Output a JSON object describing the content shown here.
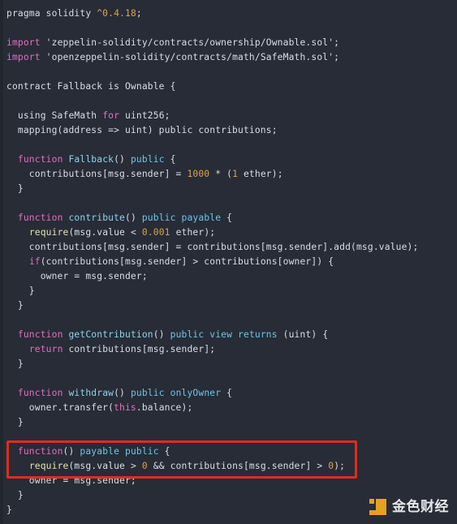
{
  "editor": {
    "language": "solidity",
    "theme_background": "#272c36",
    "default_text_color": "#d9dde6",
    "colors": {
      "keyword": "#e36ec4",
      "modifier": "#6fc3e8",
      "function_name": "#8fd3ec",
      "number": "#e0a04a",
      "builtin_call": "#e8e2a8",
      "plain": "#d9dde6",
      "annotation_box": "#e02b20",
      "watermark_accent": "#f0a81e"
    },
    "lines": [
      {
        "n": 1,
        "tokens": [
          {
            "t": "pragma solidity ",
            "c": "plain"
          },
          {
            "t": "^0.4.18",
            "c": "num"
          },
          {
            "t": ";",
            "c": "plain"
          }
        ]
      },
      {
        "n": 2,
        "tokens": []
      },
      {
        "n": 3,
        "tokens": [
          {
            "t": "import",
            "c": "kw"
          },
          {
            "t": " 'zeppelin-solidity/contracts/ownership/Ownable.sol';",
            "c": "plain"
          }
        ]
      },
      {
        "n": 4,
        "tokens": [
          {
            "t": "import",
            "c": "kw"
          },
          {
            "t": " 'openzeppelin-solidity/contracts/math/SafeMath.sol';",
            "c": "plain"
          }
        ]
      },
      {
        "n": 5,
        "tokens": []
      },
      {
        "n": 6,
        "tokens": [
          {
            "t": "contract Fallback is Ownable {",
            "c": "plain"
          }
        ]
      },
      {
        "n": 7,
        "tokens": []
      },
      {
        "n": 8,
        "tokens": [
          {
            "t": "  using SafeMath ",
            "c": "plain"
          },
          {
            "t": "for",
            "c": "kw"
          },
          {
            "t": " uint256;",
            "c": "plain"
          }
        ]
      },
      {
        "n": 9,
        "tokens": [
          {
            "t": "  mapping(address => uint) public contributions;",
            "c": "plain"
          }
        ]
      },
      {
        "n": 10,
        "tokens": []
      },
      {
        "n": 11,
        "tokens": [
          {
            "t": "  ",
            "c": "plain"
          },
          {
            "t": "function",
            "c": "kw"
          },
          {
            "t": " ",
            "c": "plain"
          },
          {
            "t": "Fallback",
            "c": "fname"
          },
          {
            "t": "() ",
            "c": "plain"
          },
          {
            "t": "public",
            "c": "mod"
          },
          {
            "t": " {",
            "c": "plain"
          }
        ]
      },
      {
        "n": 12,
        "tokens": [
          {
            "t": "    contributions[msg.sender] = ",
            "c": "plain"
          },
          {
            "t": "1000",
            "c": "num"
          },
          {
            "t": " * (",
            "c": "plain"
          },
          {
            "t": "1",
            "c": "num"
          },
          {
            "t": " ether);",
            "c": "plain"
          }
        ]
      },
      {
        "n": 13,
        "tokens": [
          {
            "t": "  }",
            "c": "plain"
          }
        ]
      },
      {
        "n": 14,
        "tokens": []
      },
      {
        "n": 15,
        "tokens": [
          {
            "t": "  ",
            "c": "plain"
          },
          {
            "t": "function",
            "c": "kw"
          },
          {
            "t": " ",
            "c": "plain"
          },
          {
            "t": "contribute",
            "c": "fname"
          },
          {
            "t": "() ",
            "c": "plain"
          },
          {
            "t": "public payable",
            "c": "mod"
          },
          {
            "t": " {",
            "c": "plain"
          }
        ]
      },
      {
        "n": 16,
        "tokens": [
          {
            "t": "    ",
            "c": "plain"
          },
          {
            "t": "require",
            "c": "call"
          },
          {
            "t": "(msg.value < ",
            "c": "plain"
          },
          {
            "t": "0.001",
            "c": "num"
          },
          {
            "t": " ether);",
            "c": "plain"
          }
        ]
      },
      {
        "n": 17,
        "tokens": [
          {
            "t": "    contributions[msg.sender] = contributions[msg.sender].add(msg.value);",
            "c": "plain"
          }
        ]
      },
      {
        "n": 18,
        "tokens": [
          {
            "t": "    ",
            "c": "plain"
          },
          {
            "t": "if",
            "c": "kw"
          },
          {
            "t": "(contributions[msg.sender] > contributions[owner]) {",
            "c": "plain"
          }
        ]
      },
      {
        "n": 19,
        "tokens": [
          {
            "t": "      owner = msg.sender;",
            "c": "plain"
          }
        ]
      },
      {
        "n": 20,
        "tokens": [
          {
            "t": "    }",
            "c": "plain"
          }
        ]
      },
      {
        "n": 21,
        "tokens": [
          {
            "t": "  }",
            "c": "plain"
          }
        ]
      },
      {
        "n": 22,
        "tokens": []
      },
      {
        "n": 23,
        "tokens": [
          {
            "t": "  ",
            "c": "plain"
          },
          {
            "t": "function",
            "c": "kw"
          },
          {
            "t": " ",
            "c": "plain"
          },
          {
            "t": "getContribution",
            "c": "fname"
          },
          {
            "t": "() ",
            "c": "plain"
          },
          {
            "t": "public view returns",
            "c": "mod"
          },
          {
            "t": " (uint) {",
            "c": "plain"
          }
        ]
      },
      {
        "n": 24,
        "tokens": [
          {
            "t": "    ",
            "c": "plain"
          },
          {
            "t": "return",
            "c": "kw"
          },
          {
            "t": " contributions[msg.sender];",
            "c": "plain"
          }
        ]
      },
      {
        "n": 25,
        "tokens": [
          {
            "t": "  }",
            "c": "plain"
          }
        ]
      },
      {
        "n": 26,
        "tokens": []
      },
      {
        "n": 27,
        "tokens": [
          {
            "t": "  ",
            "c": "plain"
          },
          {
            "t": "function",
            "c": "kw"
          },
          {
            "t": " ",
            "c": "plain"
          },
          {
            "t": "withdraw",
            "c": "fname"
          },
          {
            "t": "() ",
            "c": "plain"
          },
          {
            "t": "public onlyOwner",
            "c": "mod"
          },
          {
            "t": " {",
            "c": "plain"
          }
        ]
      },
      {
        "n": 28,
        "tokens": [
          {
            "t": "    owner.transfer(",
            "c": "plain"
          },
          {
            "t": "this",
            "c": "kw"
          },
          {
            "t": ".balance);",
            "c": "plain"
          }
        ]
      },
      {
        "n": 29,
        "tokens": [
          {
            "t": "  }",
            "c": "plain"
          }
        ]
      },
      {
        "n": 30,
        "tokens": []
      },
      {
        "n": 31,
        "tokens": [
          {
            "t": "  ",
            "c": "plain"
          },
          {
            "t": "function",
            "c": "kw"
          },
          {
            "t": "() ",
            "c": "plain"
          },
          {
            "t": "payable public",
            "c": "mod"
          },
          {
            "t": " {",
            "c": "plain"
          }
        ]
      },
      {
        "n": 32,
        "tokens": [
          {
            "t": "    ",
            "c": "plain"
          },
          {
            "t": "require",
            "c": "call"
          },
          {
            "t": "(msg.value > ",
            "c": "plain"
          },
          {
            "t": "0",
            "c": "num"
          },
          {
            "t": " && contributions[msg.sender] > ",
            "c": "plain"
          },
          {
            "t": "0",
            "c": "num"
          },
          {
            "t": ");",
            "c": "plain"
          }
        ]
      },
      {
        "n": 33,
        "tokens": [
          {
            "t": "    owner = msg.sender;",
            "c": "plain"
          }
        ]
      },
      {
        "n": 34,
        "tokens": [
          {
            "t": "  }",
            "c": "plain"
          }
        ]
      },
      {
        "n": 35,
        "tokens": [
          {
            "t": "}",
            "c": "plain"
          }
        ]
      }
    ]
  },
  "annotation": {
    "type": "highlight-rectangle",
    "color": "#e02b20",
    "covers_lines": [
      31,
      32,
      33
    ],
    "label": "fallback-function-highlight"
  },
  "watermark": {
    "text": "金色财经",
    "icon": "jinse-logo-icon",
    "accent_color": "#f0a81e"
  }
}
